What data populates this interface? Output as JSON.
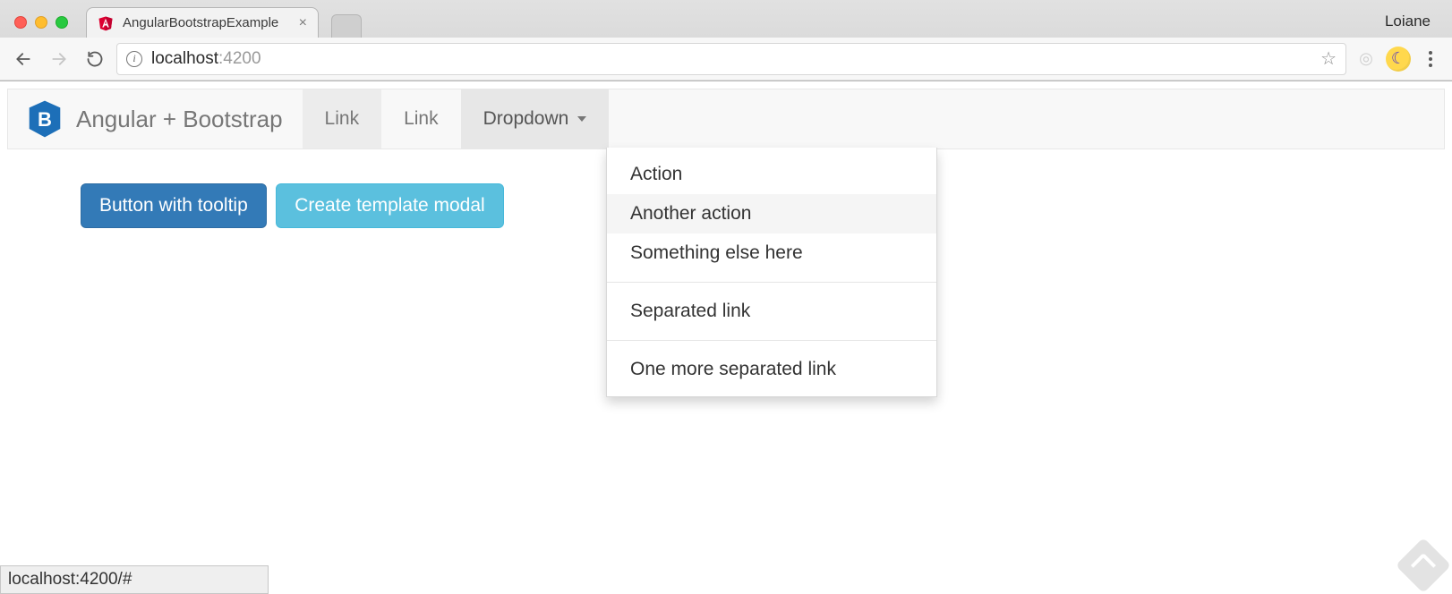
{
  "browser": {
    "tab_title": "AngularBootstrapExample",
    "profile": "Loiane",
    "url_host": "localhost",
    "url_port": ":4200"
  },
  "navbar": {
    "brand": "Angular + Bootstrap",
    "items": [
      {
        "label": "Link"
      },
      {
        "label": "Link"
      },
      {
        "label": "Dropdown"
      }
    ]
  },
  "dropdown": {
    "items": [
      {
        "label": "Action",
        "type": "item",
        "hover": false
      },
      {
        "label": "Another action",
        "type": "item",
        "hover": true
      },
      {
        "label": "Something else here",
        "type": "item",
        "hover": false
      },
      {
        "type": "divider"
      },
      {
        "label": "Separated link",
        "type": "item",
        "hover": false
      },
      {
        "type": "divider"
      },
      {
        "label": "One more separated link",
        "type": "item",
        "hover": false
      }
    ]
  },
  "buttons": {
    "tooltip": "Button with tooltip",
    "modal": "Create template modal"
  },
  "status": "localhost:4200/#"
}
